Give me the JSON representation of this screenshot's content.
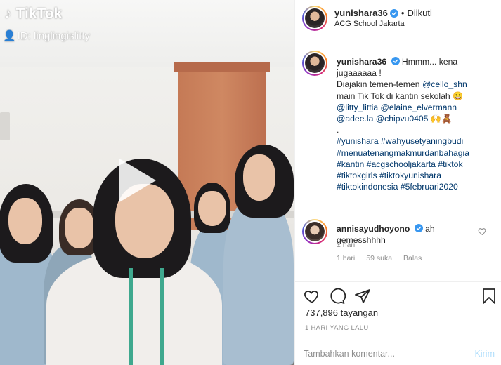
{
  "video": {
    "watermark_brand": "TikTok",
    "watermark_id": "ID: linglingislitty"
  },
  "post": {
    "username": "yunishara36",
    "follow_state": "Diikuti",
    "location": "ACG School Jakarta"
  },
  "caption": {
    "username": "yunishara36",
    "line1": "Hmmm... kena",
    "line2": "jugaaaaaa !",
    "line3_prefix": "Diajakin temen-temen ",
    "line3_mention": "@cello_shn",
    "line4": "main Tik Tok di kantin sekolah 😀",
    "line5_mention1": "@litty_littia",
    "line5_mention2": "@elaine_elvermann",
    "line6_mention1": "@adee.la",
    "line6_mention2": "@chipvu0405",
    "line6_emoji": "🙌🧸",
    "line7": ".",
    "hashtags": [
      "#yunishara #wahyusetyaningbudi",
      "#menuatenangmakmurdanbahagia",
      "#kantin #acgschooljakarta #tiktok",
      "#tiktokgirls #tiktokyunishara",
      "#tiktokindonesia #5februari2020"
    ],
    "time": "1 hari"
  },
  "comment1": {
    "username": "annisayudhoyono",
    "text_line1": "ah",
    "text_line2": "gemesshhhh",
    "time": "1 hari",
    "likes": "59 suka",
    "reply": "Balas"
  },
  "stats": {
    "views": "737,896 tayangan",
    "date": "1 HARI YANG LALU"
  },
  "comment_box": {
    "placeholder": "Tambahkan komentar...",
    "post_label": "Kirim"
  },
  "icons": {
    "like": "heart-icon",
    "comment": "comment-icon",
    "share": "share-icon",
    "save": "bookmark-icon",
    "play": "play-icon",
    "verified": "verified-badge-icon"
  },
  "colors": {
    "link": "#00376b",
    "muted": "#8e8e8e",
    "verified": "#3897f0",
    "post_button": "#b2dffc"
  }
}
